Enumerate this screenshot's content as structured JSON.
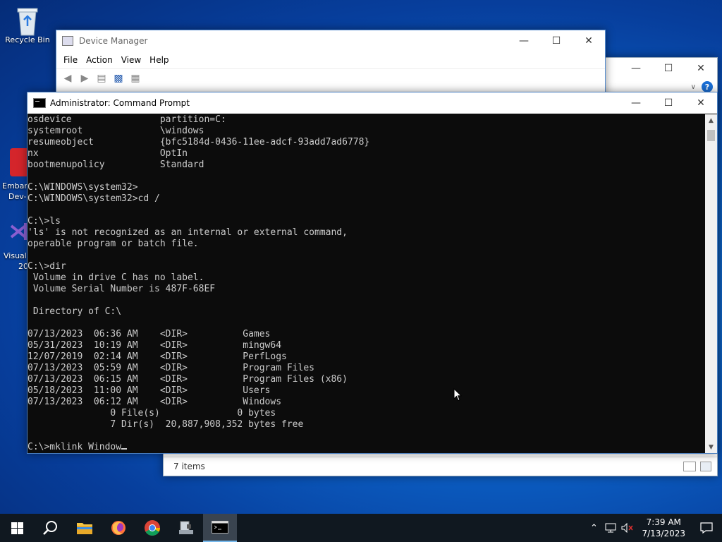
{
  "desktop": {
    "recycle_bin_label": "Recycle Bin",
    "embarcadero_partial_1": "Embarc",
    "embarcadero_partial_2": "Dev-",
    "visual_partial_1": "Visual",
    "visual_partial_2": "20"
  },
  "explorer": {
    "status_text": "7 items"
  },
  "device_manager": {
    "title": "Device Manager",
    "menu": [
      "File",
      "Action",
      "View",
      "Help"
    ]
  },
  "cmd": {
    "title": "Administrator:  Command Prompt",
    "lines": [
      "osdevice                partition=C:",
      "systemroot              \\windows",
      "resumeobject            {bfc5184d-0436-11ee-adcf-93add7ad6778}",
      "nx                      OptIn",
      "bootmenupolicy          Standard",
      "",
      "C:\\WINDOWS\\system32>",
      "C:\\WINDOWS\\system32>cd /",
      "",
      "C:\\>ls",
      "'ls' is not recognized as an internal or external command,",
      "operable program or batch file.",
      "",
      "C:\\>dir",
      " Volume in drive C has no label.",
      " Volume Serial Number is 487F-68EF",
      "",
      " Directory of C:\\",
      "",
      "07/13/2023  06:36 AM    <DIR>          Games",
      "05/31/2023  10:19 AM    <DIR>          mingw64",
      "12/07/2019  02:14 AM    <DIR>          PerfLogs",
      "07/13/2023  05:59 AM    <DIR>          Program Files",
      "07/13/2023  06:15 AM    <DIR>          Program Files (x86)",
      "05/18/2023  11:00 AM    <DIR>          Users",
      "07/13/2023  06:12 AM    <DIR>          Windows",
      "               0 File(s)              0 bytes",
      "               7 Dir(s)  20,887,908,352 bytes free",
      ""
    ],
    "prompt_line": "C:\\>mklink Window"
  },
  "taskbar": {
    "time": "7:39 AM",
    "date": "7/13/2023"
  }
}
